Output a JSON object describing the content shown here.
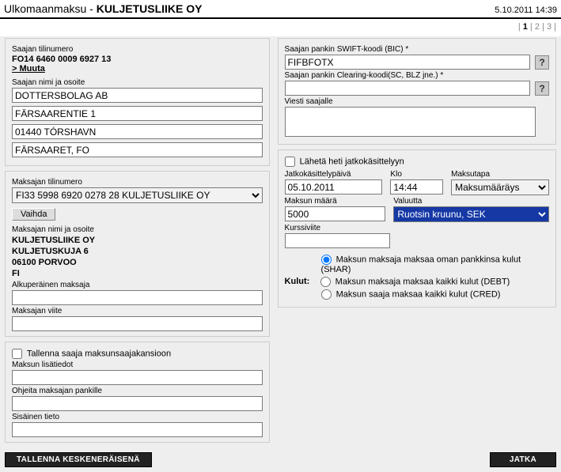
{
  "header": {
    "title_prefix": "Ulkomaanmaksu - ",
    "title_bold": "KULJETUSLIIKE OY",
    "timestamp": "5.10.2011 14:39"
  },
  "pager": {
    "p1": "1",
    "p2": "2",
    "p3": "3",
    "sep": " | "
  },
  "recipient": {
    "account_label": "Saajan tilinumero",
    "account_value": "FO14 6460 0009 6927 13",
    "change_link": "> Muuta",
    "name_addr_label": "Saajan nimi ja osoite",
    "name": "DOTTERSBOLAG AB",
    "addr1": "FÄRSAARENTIE 1",
    "addr2": "01440 TÓRSHAVN",
    "country": "FÄRSAARET, FO",
    "swift_label": "Saajan pankin SWIFT-koodi (BIC)",
    "swift_value": "FIFBFOTX",
    "clearing_label": "Saajan pankin Clearing-koodi(SC, BLZ jne.)",
    "clearing_value": "",
    "message_label": "Viesti saajalle",
    "message_value": "",
    "help": "?"
  },
  "payer": {
    "account_label": "Maksajan tilinumero",
    "account_value": "FI33 5998 6920 0278 28 KULJETUSLIIKE OY",
    "change_btn": "Vaihda",
    "name_addr_label": "Maksajan nimi ja osoite",
    "line1": "KULJETUSLIIKE OY",
    "line2": "KULJETUSKUJA 6",
    "line3": "06100 PORVOO",
    "line4": "FI",
    "orig_payer_label": "Alkuperäinen maksaja",
    "orig_payer_value": "",
    "ref_label": "Maksajan viite",
    "ref_value": ""
  },
  "payment": {
    "send_immediate_label": "Lähetä heti jatkokäsittelyyn",
    "send_immediate_checked": false,
    "processing_date_label": "Jatkokäsittelypäivä",
    "processing_date_value": "05.10.2011",
    "time_label": "Klo",
    "time_value": "14:44",
    "method_label": "Maksutapa",
    "method_value": "Maksumääräys",
    "amount_label": "Maksun määrä",
    "amount_value": "5000",
    "currency_label": "Valuutta",
    "currency_value": "Ruotsin kruunu, SEK",
    "rate_ref_label": "Kurssiviite",
    "rate_ref_value": "",
    "charges_label": "Kulut:",
    "charge_shar": "Maksun maksaja maksaa oman pankkinsa kulut (SHAR)",
    "charge_debt": "Maksun maksaja maksaa kaikki kulut (DEBT)",
    "charge_cred": "Maksun saaja maksaa kaikki kulut (CRED)",
    "charge_selected": "shar",
    "save_benef_label": "Tallenna saaja maksunsaajakansioon",
    "save_benef_checked": false,
    "extra_info_label": "Maksun lisätiedot",
    "extra_info_value": "",
    "bank_instr_label": "Ohjeita maksajan pankille",
    "bank_instr_value": "",
    "internal_note_label": "Sisäinen tieto",
    "internal_note_value": ""
  },
  "footer": {
    "save_draft": "TALLENNA KESKENERÄISENÄ",
    "continue": "JATKA"
  }
}
